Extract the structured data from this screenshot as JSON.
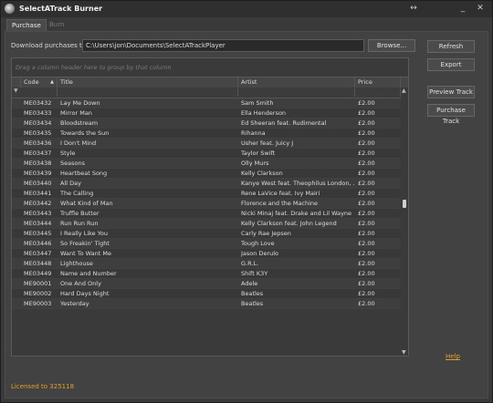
{
  "window": {
    "title": "SelectATrack Burner",
    "controls": [
      "↔",
      "_",
      "✕"
    ]
  },
  "tabs": [
    {
      "label": "Purchase"
    },
    {
      "label": "Burn"
    }
  ],
  "download": {
    "label": "Download purchases to",
    "path": "C:\\Users\\jon\\Documents\\SelectATrackPlayer",
    "browse_label": "Browse..."
  },
  "side_buttons": {
    "refresh": "Refresh",
    "export": "Export",
    "preview": "Preview Track",
    "purchase": "Purchase Track"
  },
  "grid": {
    "group_hint": "Drag a column header here to group by that column",
    "columns": [
      "Code",
      "Title",
      "Artist",
      "Price"
    ],
    "sort_indicator": "▲",
    "filter_icon": "▼",
    "rows": [
      [
        "ME03432",
        "Lay Me Down",
        "Sam Smith",
        "£2.00"
      ],
      [
        "ME03433",
        "Mirror Man",
        "Ella Henderson",
        "£2.00"
      ],
      [
        "ME03434",
        "Bloodstream",
        "Ed Sheeran feat. Rudimental",
        "£2.00"
      ],
      [
        "ME03435",
        "Towards the Sun",
        "Rihanna",
        "£2.00"
      ],
      [
        "ME03436",
        "I Don't Mind",
        "Usher feat. Juicy J",
        "£2.00"
      ],
      [
        "ME03437",
        "Style",
        "Taylor Swift",
        "£2.00"
      ],
      [
        "ME03438",
        "Seasons",
        "Olly Murs",
        "£2.00"
      ],
      [
        "ME03439",
        "Heartbeat Song",
        "Kelly Clarkson",
        "£2.00"
      ],
      [
        "ME03440",
        "All Day",
        "Kanye West feat. Theophilus London, ...",
        "£2.00"
      ],
      [
        "ME03441",
        "The Calling",
        "Rene LaVice feat. Ivy Mairi",
        "£2.00"
      ],
      [
        "ME03442",
        "What Kind of Man",
        "Florence and the Machine",
        "£2.00"
      ],
      [
        "ME03443",
        "Truffle Butter",
        "Nicki Minaj feat. Drake and Lil Wayne",
        "£2.00"
      ],
      [
        "ME03444",
        "Run Run Run",
        "Kelly Clarkson feat. John Legend",
        "£2.00"
      ],
      [
        "ME03445",
        "I Really Like You",
        "Carly Rae Jepsen",
        "£2.00"
      ],
      [
        "ME03446",
        "So Freakin' Tight",
        "Tough Love",
        "£2.00"
      ],
      [
        "ME03447",
        "Want To Want Me",
        "Jason Derulo",
        "£2.00"
      ],
      [
        "ME03448",
        "Lighthouse",
        "G.R.L.",
        "£2.00"
      ],
      [
        "ME03449",
        "Name and Number",
        "Shift K3Y",
        "£2.00"
      ],
      [
        "ME90001",
        "One And Only",
        "Adele",
        "£2.00"
      ],
      [
        "ME90002",
        "Hard Days Night",
        "Beatles",
        "£2.00"
      ],
      [
        "ME90003",
        "Yesterday",
        "Beatles",
        "£2.00"
      ]
    ]
  },
  "help_label": "Help",
  "license_text": "Licensed to 325118",
  "colors": {
    "accent": "#e0a030",
    "background": "#3a3a3a"
  }
}
